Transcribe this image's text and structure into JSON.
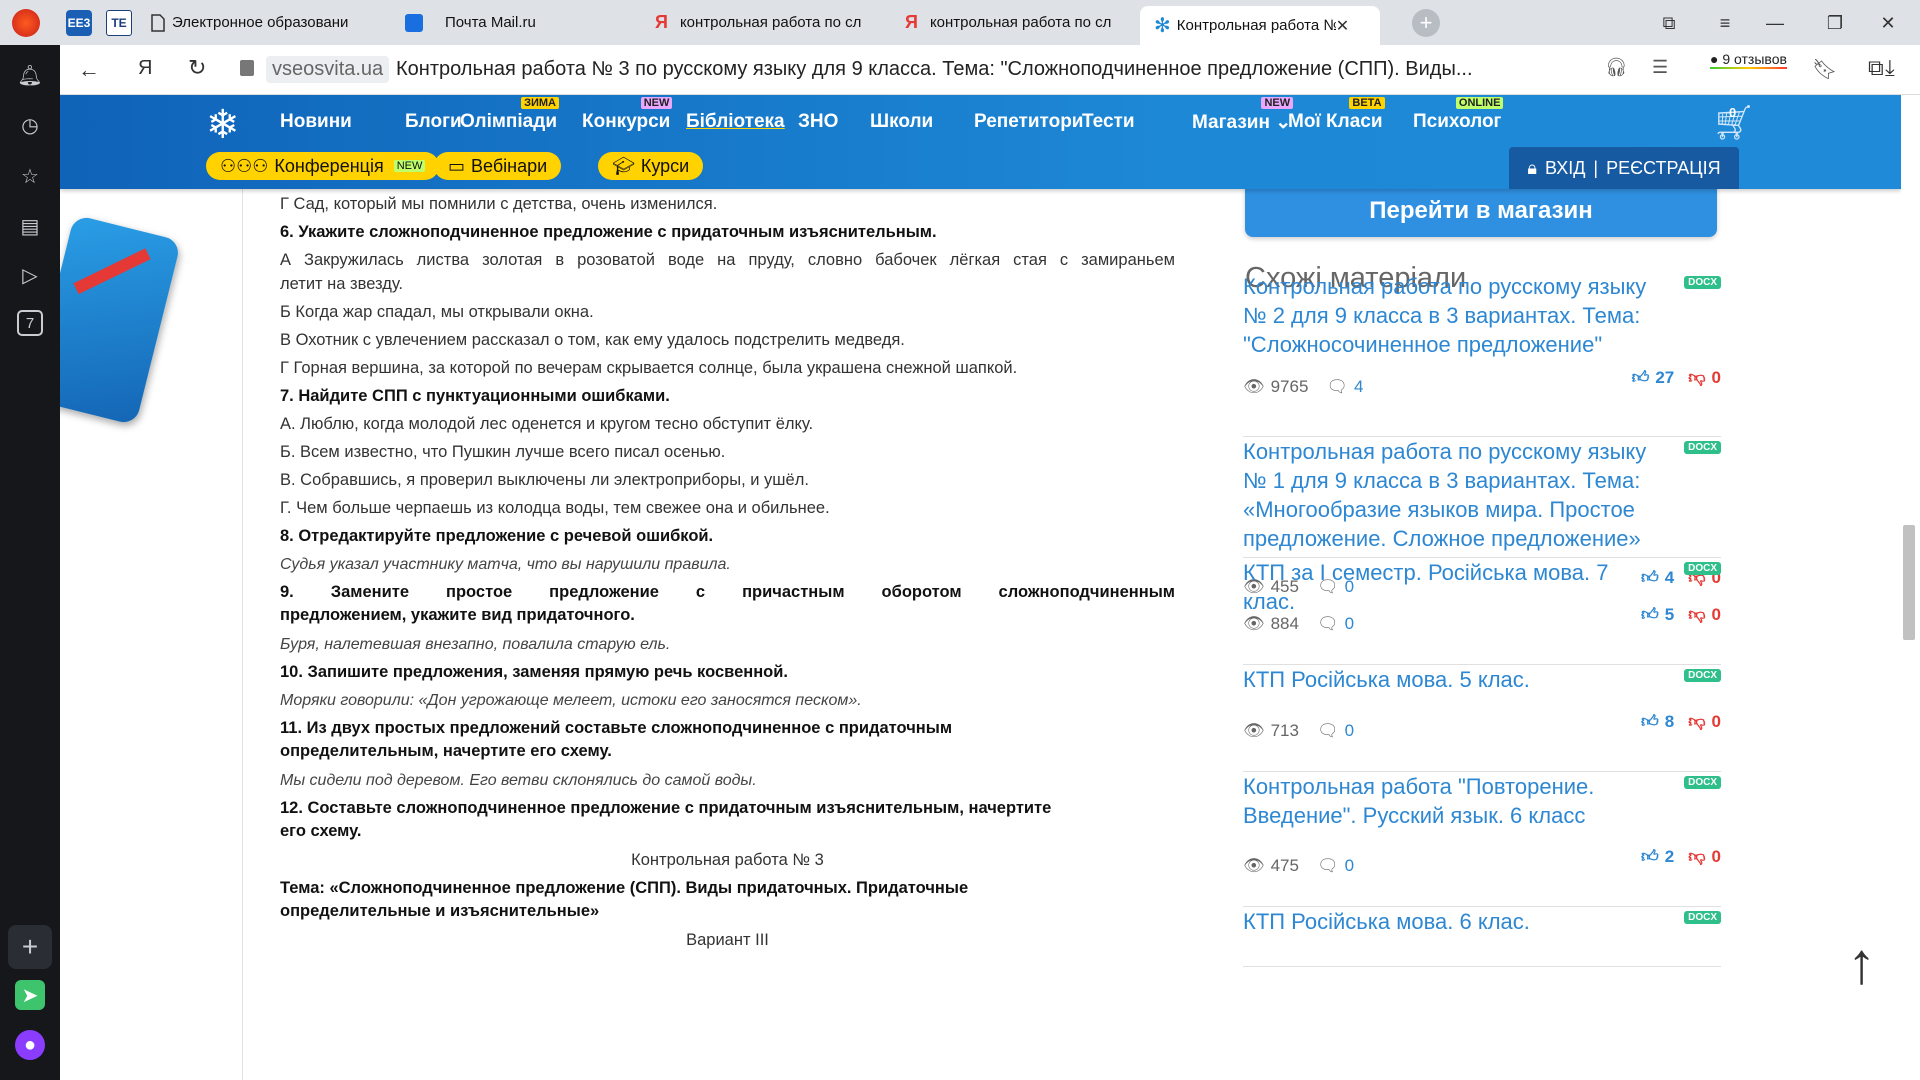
{
  "tabs": [
    {
      "label": "Электронное образовани"
    },
    {
      "label": "Почта Mail.ru"
    },
    {
      "label": "контрольная работа по сл"
    },
    {
      "label": "контрольная работа по сл"
    },
    {
      "label": "Контрольная работа №"
    }
  ],
  "pinned": [
    "EE3",
    "TE"
  ],
  "address": {
    "domain": "vseosvita.ua",
    "title": "Контрольная работа № 3 по русскому языку для 9 класса. Тема: \"Сложноподчиненное предложение (СПП). Виды...",
    "reviews": "9 отзывов"
  },
  "sidebar_counter": "7",
  "site": {
    "nav": [
      {
        "label": "Новини",
        "badge": ""
      },
      {
        "label": "Блоги",
        "badge": ""
      },
      {
        "label": "Олімпіади",
        "badge": "ЗИМА"
      },
      {
        "label": "Конкурси",
        "badge": "NEW"
      },
      {
        "label": "Бібліотека",
        "badge": ""
      },
      {
        "label": "ЗНО",
        "badge": ""
      },
      {
        "label": "Школи",
        "badge": ""
      },
      {
        "label": "Репетитори",
        "badge": ""
      },
      {
        "label": "Тести",
        "badge": ""
      },
      {
        "label": "Магазин",
        "badge": "NEW"
      },
      {
        "label": "Мої Класи",
        "badge": "BETA"
      },
      {
        "label": "Психолог",
        "badge": "ONLINE"
      }
    ],
    "cart_count": "0",
    "pills": [
      {
        "label": "Конференція",
        "badge": "NEW"
      },
      {
        "label": "Вебінари"
      },
      {
        "label": "Курси"
      }
    ],
    "login": "ВХІД",
    "register": "РЕЄСТРАЦІЯ"
  },
  "article": [
    "Г Сад, который мы помнили с детства, очень изменился.",
    "6. Укажите сложноподчиненное предложение с придаточным изъяснительным.",
    "А Закружилась листва золотая в розоватой воде на пруду, словно бабочек лёгкая стая с замираньем",
    "летит на звезду.",
    "Б Когда жар спадал, мы открывали окна.",
    "В Охотник с увлечением рассказал о том, как ему удалось подстрелить медведя.",
    "Г Горная вершина, за которой по вечерам скрывается солнце, была украшена снежной шапкой.",
    "7. Найдите СПП с пунктуационными ошибками.",
    "А. Люблю, когда молодой лес оденется и кругом тесно обступит ёлку.",
    "Б. Всем известно, что Пушкин лучше всего писал осенью.",
    "В. Собравшись, я проверил выключены ли электроприборы, и ушёл.",
    "Г. Чем больше черпаешь из колодца воды, тем свежее она и обильнее.",
    "8. Отредактируйте предложение с речевой ошибкой.",
    "Судья указал участнику матча, что вы нарушили правила.",
    "9. Замените простое предложение с причастным оборотом сложноподчиненным",
    "предложением, укажите вид придаточного.",
    "Буря, налетевшая внезапно, повалила старую ель.",
    "10. Запишите предложения, заменяя прямую речь косвенной.",
    "Моряки говорили: «Дон угрожающе мелеет, истоки его заносятся песком».",
    "11. Из двух простых предложений составьте сложноподчиненное с придаточным",
    "определительным, начертите его схему.",
    "Мы сидели под деревом. Его ветви склонялись до самой воды.",
    "12. Составьте сложноподчиненное предложение с придаточным изъяснительным, начертите",
    "его схему.",
    "Контрольная работа № 3",
    "Тема: «Сложноподчиненное предложение (СПП). Виды придаточных. Придаточные",
    "определительные и изъяснительные»",
    "Вариант III"
  ],
  "shop_button": "Перейти в магазин",
  "similar_title": "Схожі матеріали",
  "materials": [
    {
      "title": "Контрольная работа по русскому языку № 2 для 9 класса в 3 вариантах. Тема: \"Сложносочиненное предложение\"",
      "type": "DOCX",
      "views": "9765",
      "comments": "4",
      "likes": "27",
      "dislikes": "0"
    },
    {
      "title": "Контрольная работа по русскому языку № 1 для 9 класса в 3 вариантах. Тема: «Многообразие языков мира. Простое предложение. Сложное предложение»",
      "type": "DOCX",
      "views": "455",
      "comments": "0",
      "likes": "4",
      "dislikes": "0"
    },
    {
      "title": "КТП за I семестр. Російська мова. 7 клас.",
      "type": "DOCX",
      "views": "884",
      "comments": "0",
      "likes": "5",
      "dislikes": "0"
    },
    {
      "title": "КТП Російська мова. 5 клас.",
      "type": "DOCX",
      "views": "713",
      "comments": "0",
      "likes": "8",
      "dislikes": "0"
    },
    {
      "title": "Контрольная работа \"Повторение. Введение\". Русский язык. 6 класс",
      "type": "DOCX",
      "views": "475",
      "comments": "0",
      "likes": "2",
      "dislikes": "0"
    },
    {
      "title": "КТП Російська мова. 6 клас.",
      "type": "DOCX",
      "views": "",
      "comments": "",
      "likes": "",
      "dislikes": ""
    }
  ],
  "colors": {
    "header": "#1978c8",
    "accent": "#ffd200",
    "link": "#2d87d2",
    "docx": "#2fbf8b",
    "like": "#2d87d2",
    "dislike": "#e53935"
  }
}
